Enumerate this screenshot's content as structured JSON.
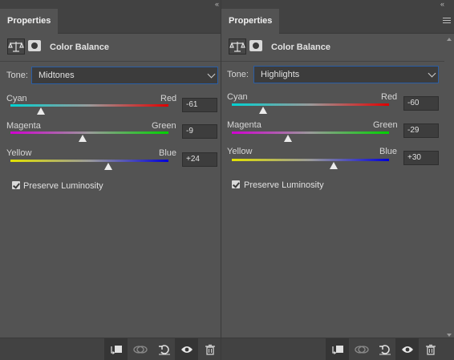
{
  "panels": [
    {
      "tab_label": "Properties",
      "collapse_glyph": "«",
      "adjustment_title": "Color Balance",
      "tone": {
        "label": "Tone:",
        "value": "Midtones"
      },
      "sliders": [
        {
          "left_label": "Cyan",
          "right_label": "Red",
          "value": "-61",
          "level": -61,
          "colors": [
            "#00d2d2",
            "#e00000"
          ]
        },
        {
          "left_label": "Magenta",
          "right_label": "Green",
          "value": "-9",
          "level": -9,
          "colors": [
            "#d000d0",
            "#00d200"
          ]
        },
        {
          "left_label": "Yellow",
          "right_label": "Blue",
          "value": "+24",
          "level": 24,
          "colors": [
            "#e2e200",
            "#0000d8"
          ]
        }
      ],
      "preserve_luminosity": {
        "label": "Preserve Luminosity",
        "checked": true
      }
    },
    {
      "tab_label": "Properties",
      "collapse_glyph": "«",
      "adjustment_title": "Color Balance",
      "tone": {
        "label": "Tone:",
        "value": "Highlights"
      },
      "sliders": [
        {
          "left_label": "Cyan",
          "right_label": "Red",
          "value": "-60",
          "level": -60,
          "colors": [
            "#00d2d2",
            "#e00000"
          ]
        },
        {
          "left_label": "Magenta",
          "right_label": "Green",
          "value": "-29",
          "level": -29,
          "colors": [
            "#d000d0",
            "#00d200"
          ]
        },
        {
          "left_label": "Yellow",
          "right_label": "Blue",
          "value": "+30",
          "level": 30,
          "colors": [
            "#e2e200",
            "#0000d8"
          ]
        }
      ],
      "preserve_luminosity": {
        "label": "Preserve Luminosity",
        "checked": true
      }
    }
  ],
  "footer_icons": [
    "clip-to-layer-icon",
    "view-previous-state-icon",
    "reset-icon",
    "visibility-eye-icon",
    "trash-icon"
  ],
  "colors": {
    "panel_bg": "#535353",
    "tabbar_bg": "#424242",
    "focus_border": "#2a5ea5"
  }
}
